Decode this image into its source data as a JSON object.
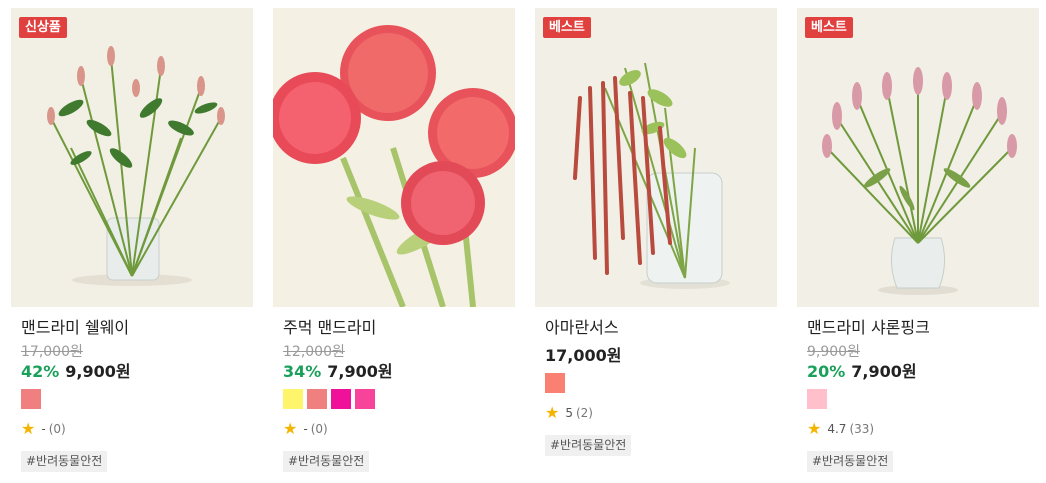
{
  "products": [
    {
      "badge": "신상품",
      "name": "맨드라미 쉘웨이",
      "original_price": "17,000원",
      "discount": "42%",
      "price": "9,900원",
      "swatches": [
        "#f08080"
      ],
      "rating": "-",
      "review_count": "(0)",
      "tag": "#반려동물안전",
      "image": "celosia-shellway-in-vase"
    },
    {
      "badge": "",
      "name": "주먹 맨드라미",
      "original_price": "12,000원",
      "discount": "34%",
      "price": "7,900원",
      "swatches": [
        "#fff56a",
        "#f08080",
        "#f0119a",
        "#f7439a"
      ],
      "rating": "-",
      "review_count": "(0)",
      "tag": "#반려동물안전",
      "image": "coral-celosia-cockscomb"
    },
    {
      "badge": "베스트",
      "name": "아마란서스",
      "original_price": "",
      "discount": "",
      "price": "17,000원",
      "swatches": [
        "#fa8072"
      ],
      "rating": "5",
      "review_count": "(2)",
      "tag": "#반려동물안전",
      "image": "amaranthus-in-glass-vase"
    },
    {
      "badge": "베스트",
      "name": "맨드라미 샤론핑크",
      "original_price": "9,900원",
      "discount": "20%",
      "price": "7,900원",
      "swatches": [
        "#ffc0cb"
      ],
      "rating": "4.7",
      "review_count": "(33)",
      "tag": "#반려동물안전",
      "image": "celosia-sharon-pink-in-vase"
    }
  ],
  "colors": {
    "badge": "#e0413f",
    "discount": "#1aa05a",
    "star": "#f5b400"
  },
  "icons": {
    "rating": "star-icon"
  }
}
